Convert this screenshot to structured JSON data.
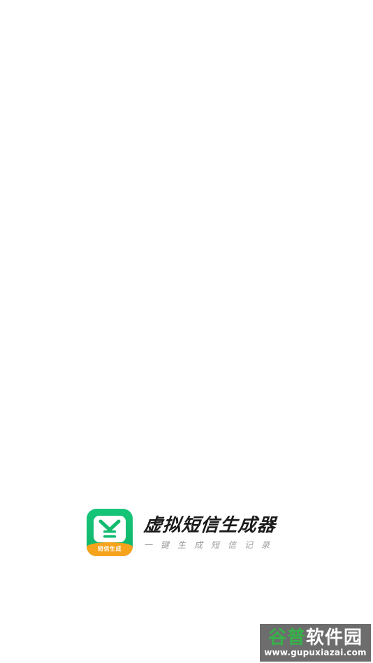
{
  "brand": {
    "icon_label": "短信生成",
    "title": "虚拟短信生成器",
    "slogan": "一键生成短信记录",
    "colors": {
      "icon_green": "#12bb70",
      "icon_orange": "#f7a21b",
      "title": "#1a1a1a",
      "slogan": "#999999"
    },
    "icon_name": "message-envelope-icon"
  },
  "watermark": {
    "text_part1": "谷普",
    "text_part2": "软件园",
    "url": "www.gupuxiazai.com",
    "colors": {
      "background": "#6d6d6d",
      "accent": "#37b24a"
    }
  }
}
